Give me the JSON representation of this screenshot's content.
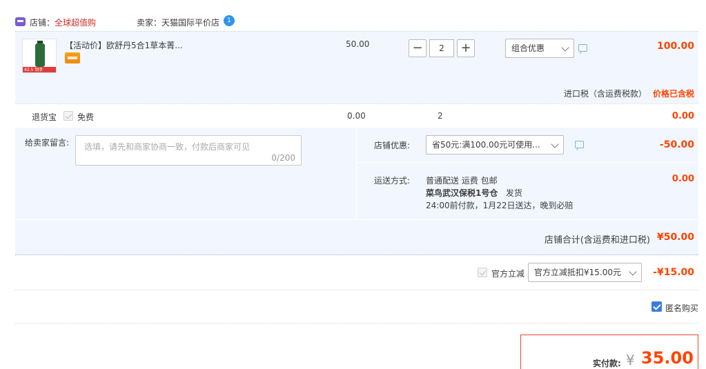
{
  "shop": {
    "shop_label": "店铺：",
    "shop_name": "全球超值购",
    "seller_label": "卖家：天猫国际平价店"
  },
  "item": {
    "image_tag": "42.5 到手",
    "title": "【活动价】欧舒丹5合1草本菁...",
    "unit_price": "50.00",
    "qty_minus": "−",
    "qty_value": "2",
    "qty_plus": "+",
    "promo": "组合优惠",
    "total": "100.00",
    "tax_label": "进口税（含运费税款）",
    "tax_value": "价格已含税"
  },
  "return_insurance": {
    "label": "退货宝",
    "free": "免费",
    "price": "0.00",
    "qty": "2",
    "total": "0.00"
  },
  "message": {
    "label": "给卖家留言:",
    "placeholder": "选填，请先和商家协商一致，付款后商家可见",
    "count": "0/200"
  },
  "coupon": {
    "label": "店铺优惠:",
    "selected": "省50元:满100.00元可使用...",
    "value": "-50.00"
  },
  "shipping": {
    "label": "运送方式:",
    "line1": "普通配送 运费 包邮",
    "warehouse": "菜鸟武汉保税1号仓",
    "ship_note": "发货",
    "line3": "24:00前付款，1月22日送达，晚到必赔",
    "value": "0.00"
  },
  "summary": {
    "label": "店铺合计(含运费和进口税)",
    "value": "¥50.00"
  },
  "official_discount": {
    "label": "官方立减",
    "selected": "官方立减抵扣¥15.00元",
    "value": "-¥15.00"
  },
  "anonymous": {
    "label": "匿名购买",
    "checked": true
  },
  "payment": {
    "label": "实付款:",
    "currency": "¥",
    "amount": "35.00"
  },
  "colors": {
    "price": "#ff4400",
    "shop_name": "#d22a2a",
    "panel_bg": "#f2f7ff",
    "checkbox": "#3a7be0"
  }
}
